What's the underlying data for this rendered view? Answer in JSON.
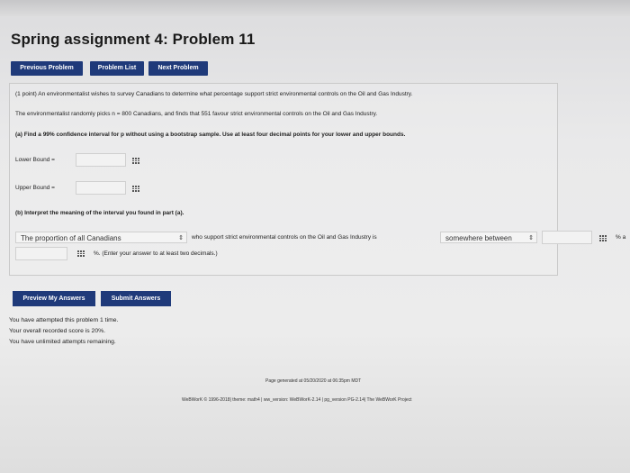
{
  "title": "Spring assignment 4: Problem 11",
  "nav": {
    "previous": "Previous Problem",
    "list": "Problem List",
    "next": "Next Problem"
  },
  "problem": {
    "intro": "(1 point) An environmentalist wishes to survey Canadians to determine what percentage support strict environmental controls on the Oil and Gas Industry.",
    "line2": "The environmentalist randomly picks n = 800 Canadians, and finds that 551 favour strict environmental controls on the Oil and Gas Industry.",
    "part_a": "(a) Find a 99% confidence interval for p without using a bootstrap sample. Use at least four decimal points for your lower and upper bounds.",
    "lower_label": "Lower Bound =",
    "upper_label": "Upper Bound =",
    "part_b": "(b) Interpret the meaning of the interval you found in part (a).",
    "select1": "The proportion of all Canadians",
    "mid_text": "who support strict environmental controls on the Oil and Gas Industry is",
    "select2": "somewhere between",
    "right_edge": "% a",
    "enter_hint": "%. (Enter your answer to at least two decimals.)"
  },
  "actions": {
    "preview": "Preview My Answers",
    "submit": "Submit Answers"
  },
  "status": {
    "attempted": "You have attempted this problem 1 time.",
    "score": "Your overall recorded score is 20%.",
    "attempts": "You have unlimited attempts remaining."
  },
  "footer": {
    "generated": "Page generated at 05/20/2020 at 06:35pm MDT",
    "credits": "WeBWorK © 1996-2018| theme: math4 | ww_version: WeBWorK-2.14 | pg_version PG-2.14| The WeBWorK Project"
  },
  "colors": {
    "button_bg": "#1f3a7a"
  }
}
